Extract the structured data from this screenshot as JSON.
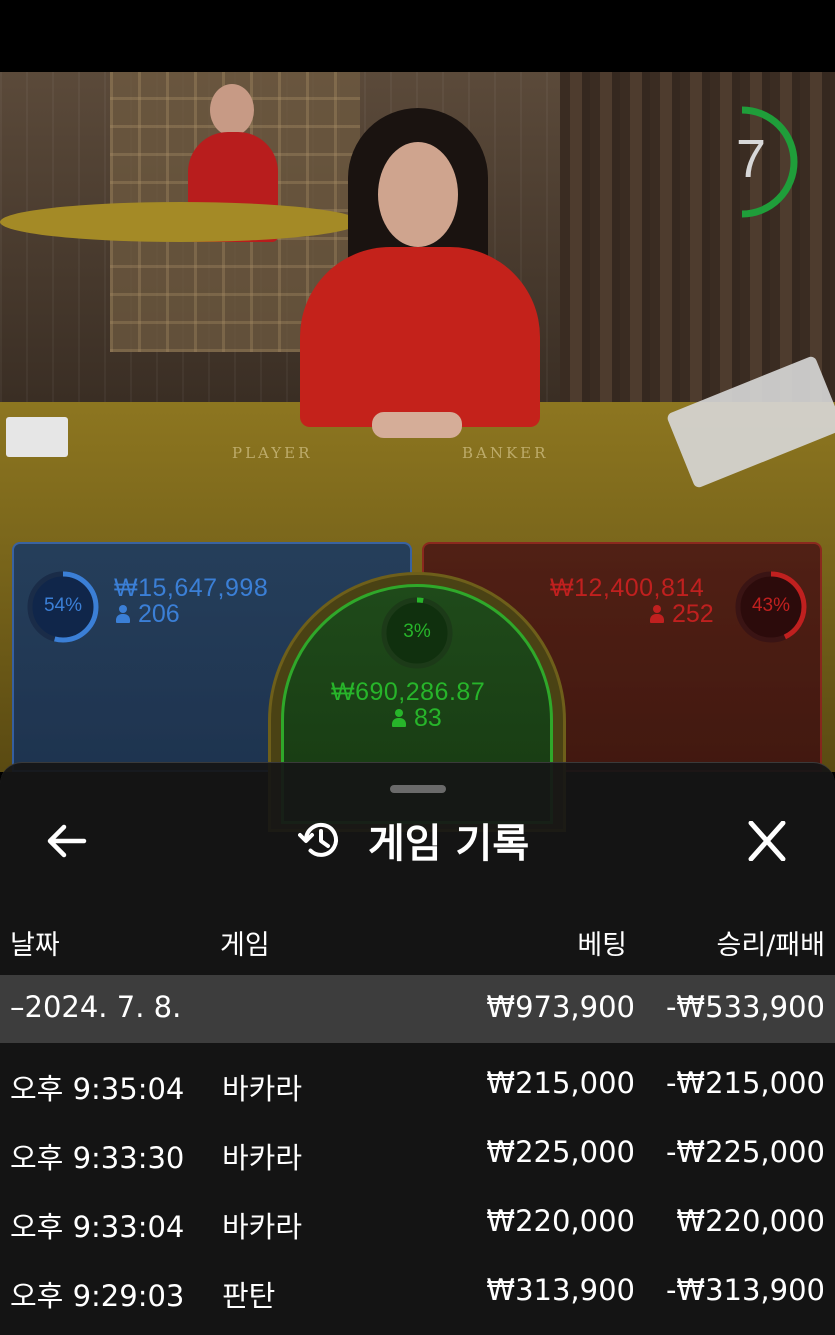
{
  "video": {
    "timer": "7",
    "table_labels": {
      "player": "PLAYER",
      "banker": "BANKER"
    }
  },
  "bets": {
    "player": {
      "percent": "54%",
      "amount": "₩15,647,998",
      "players": "206",
      "color": "#3b7fd6",
      "fill": 0.54
    },
    "tie": {
      "percent": "3%",
      "amount": "₩690,286.87",
      "players": "83",
      "color": "#27b52a",
      "fill": 0.03
    },
    "banker": {
      "percent": "43%",
      "amount": "₩12,400,814",
      "players": "252",
      "color": "#c0201f",
      "fill": 0.43
    }
  },
  "panel": {
    "title": "게임 기록",
    "back_icon": "arrow-left-icon",
    "history_icon": "history-icon",
    "close_icon": "close-icon",
    "columns": {
      "date": "날짜",
      "game": "게임",
      "bet": "베팅",
      "result": "승리/패배"
    },
    "date_row": {
      "date": "–2024. 7. 8.",
      "bet": "₩973,900",
      "result": "-₩533,900"
    },
    "rows": [
      {
        "time": "오후 9:35:04",
        "game": "바카라",
        "bet": "₩215,000",
        "result": "-₩215,000"
      },
      {
        "time": "오후 9:33:30",
        "game": "바카라",
        "bet": "₩225,000",
        "result": "-₩225,000"
      },
      {
        "time": "오후 9:33:04",
        "game": "바카라",
        "bet": "₩220,000",
        "result": "₩220,000"
      },
      {
        "time": "오후 9:29:03",
        "game": "판탄",
        "bet": "₩313,900",
        "result": "-₩313,900"
      }
    ]
  }
}
